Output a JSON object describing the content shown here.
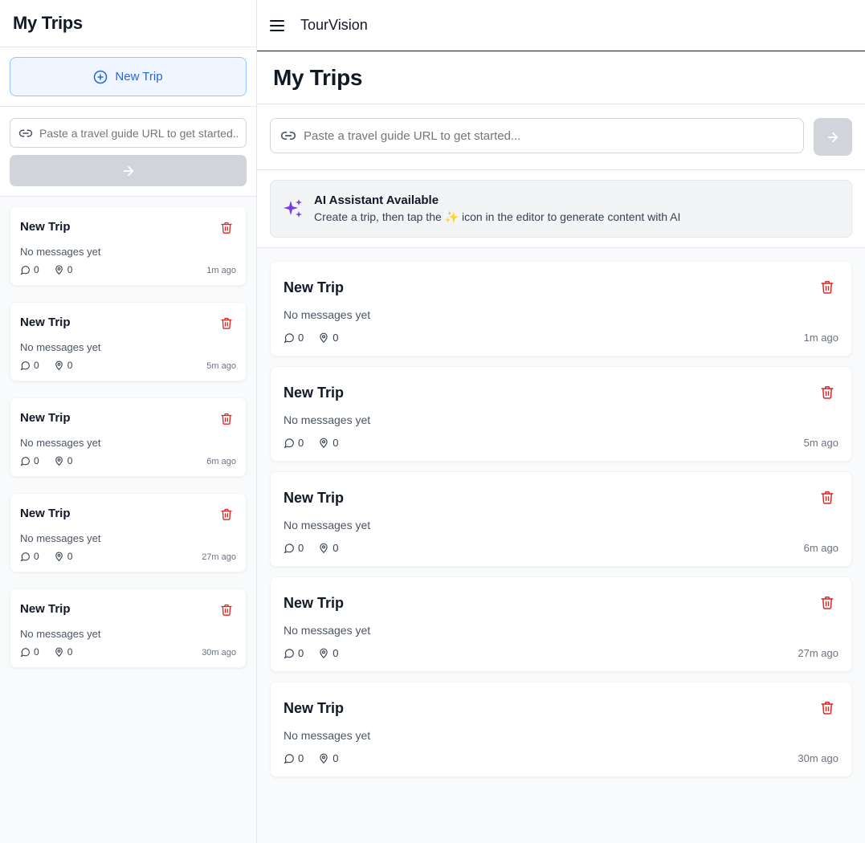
{
  "app": {
    "brand": "TourVision"
  },
  "colors": {
    "accent": "#2563eb",
    "danger": "#dc2626",
    "ai": "#7c3aed"
  },
  "sidebar": {
    "title": "My Trips",
    "new_trip_label": "New Trip",
    "url_placeholder": "Paste a travel guide URL to get started...",
    "trips": [
      {
        "title": "New Trip",
        "message": "No messages yet",
        "messages": "0",
        "places": "0",
        "time": "1m ago"
      },
      {
        "title": "New Trip",
        "message": "No messages yet",
        "messages": "0",
        "places": "0",
        "time": "5m ago"
      },
      {
        "title": "New Trip",
        "message": "No messages yet",
        "messages": "0",
        "places": "0",
        "time": "6m ago"
      },
      {
        "title": "New Trip",
        "message": "No messages yet",
        "messages": "0",
        "places": "0",
        "time": "27m ago"
      },
      {
        "title": "New Trip",
        "message": "No messages yet",
        "messages": "0",
        "places": "0",
        "time": "30m ago"
      }
    ]
  },
  "main": {
    "title": "My Trips",
    "url_placeholder": "Paste a travel guide URL to get started...",
    "ai": {
      "title": "AI Assistant Available",
      "subtitle": "Create a trip, then tap the ✨ icon in the editor to generate content with AI"
    },
    "trips": [
      {
        "title": "New Trip",
        "message": "No messages yet",
        "messages": "0",
        "places": "0",
        "time": "1m ago"
      },
      {
        "title": "New Trip",
        "message": "No messages yet",
        "messages": "0",
        "places": "0",
        "time": "5m ago"
      },
      {
        "title": "New Trip",
        "message": "No messages yet",
        "messages": "0",
        "places": "0",
        "time": "6m ago"
      },
      {
        "title": "New Trip",
        "message": "No messages yet",
        "messages": "0",
        "places": "0",
        "time": "27m ago"
      },
      {
        "title": "New Trip",
        "message": "No messages yet",
        "messages": "0",
        "places": "0",
        "time": "30m ago"
      }
    ]
  }
}
